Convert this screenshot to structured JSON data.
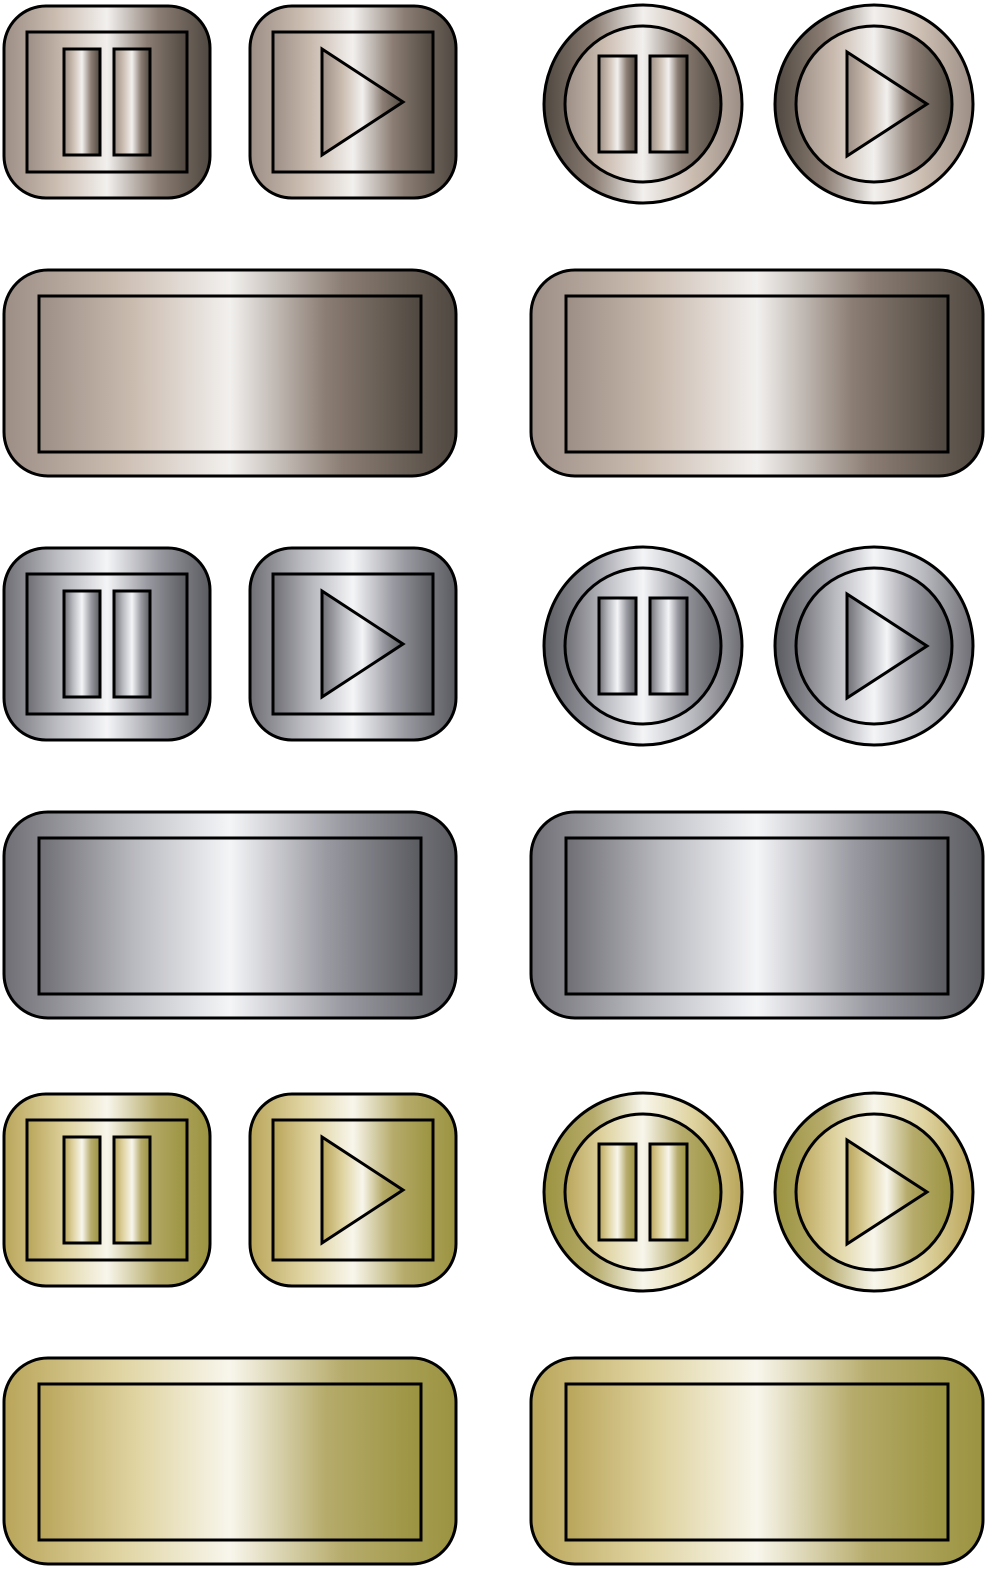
{
  "themes": [
    {
      "name": "bronze",
      "colors": [
        "#9c8e85",
        "#cbbcb0",
        "#f2f0ee",
        "#8b7d73",
        "#4f4840"
      ]
    },
    {
      "name": "silver",
      "colors": [
        "#6e6e74",
        "#b9bac0",
        "#f4f5f7",
        "#9a9aa2",
        "#5a5b60"
      ]
    },
    {
      "name": "gold",
      "colors": [
        "#b9a55a",
        "#dfd3a0",
        "#f8f6ec",
        "#b6ab6b",
        "#9b9340"
      ]
    }
  ],
  "button_sets": [
    {
      "theme": "bronze",
      "buttons": [
        {
          "kind": "square",
          "icon": "pause-icon"
        },
        {
          "kind": "square",
          "icon": "play-icon"
        },
        {
          "kind": "round",
          "icon": "pause-icon"
        },
        {
          "kind": "round",
          "icon": "play-icon"
        },
        {
          "kind": "plate"
        },
        {
          "kind": "plate"
        }
      ]
    },
    {
      "theme": "silver",
      "buttons": [
        {
          "kind": "square",
          "icon": "pause-icon"
        },
        {
          "kind": "square",
          "icon": "play-icon"
        },
        {
          "kind": "round",
          "icon": "pause-icon"
        },
        {
          "kind": "round",
          "icon": "play-icon"
        },
        {
          "kind": "plate"
        },
        {
          "kind": "plate"
        }
      ]
    },
    {
      "theme": "gold",
      "buttons": [
        {
          "kind": "square",
          "icon": "pause-icon"
        },
        {
          "kind": "square",
          "icon": "play-icon"
        },
        {
          "kind": "round",
          "icon": "pause-icon"
        },
        {
          "kind": "round",
          "icon": "play-icon"
        },
        {
          "kind": "plate"
        },
        {
          "kind": "plate"
        }
      ]
    }
  ]
}
